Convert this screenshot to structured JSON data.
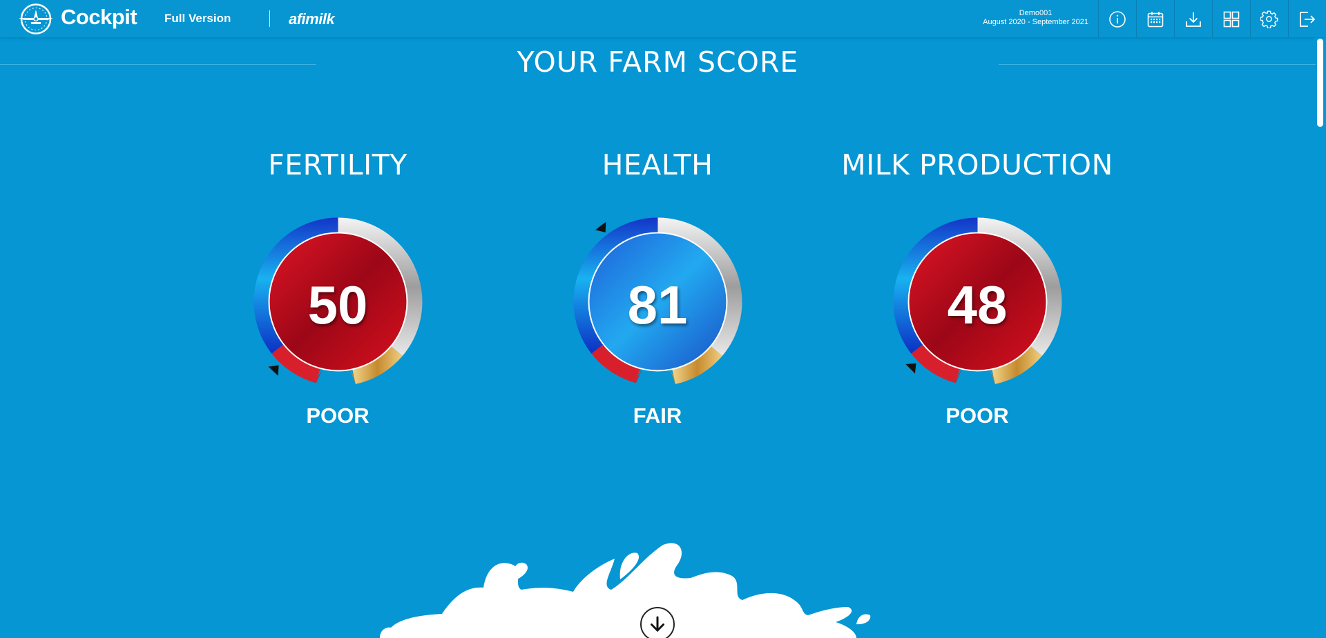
{
  "header": {
    "brand": "Cockpit",
    "version": "Full Version",
    "partner": "afimilk",
    "farm_name": "Demo001",
    "date_range": "August 2020 - September 2021",
    "tools": [
      "info-icon",
      "calendar-icon",
      "download-icon",
      "grid-icon",
      "gear-icon",
      "logout-icon"
    ]
  },
  "page": {
    "title": "YOUR FARM SCORE"
  },
  "scores": [
    {
      "title": "FERTILITY",
      "value": "50",
      "rating": "POOR",
      "face": "red"
    },
    {
      "title": "HEALTH",
      "value": "81",
      "rating": "FAIR",
      "face": "blue"
    },
    {
      "title": "MILK PRODUCTION",
      "value": "48",
      "rating": "POOR",
      "face": "red"
    }
  ],
  "colors": {
    "background": "#0596d3",
    "poor": "#c40f1e",
    "fair": "#1a73e0",
    "good": "#d9a24a",
    "excellent": "#c0c0c0"
  }
}
